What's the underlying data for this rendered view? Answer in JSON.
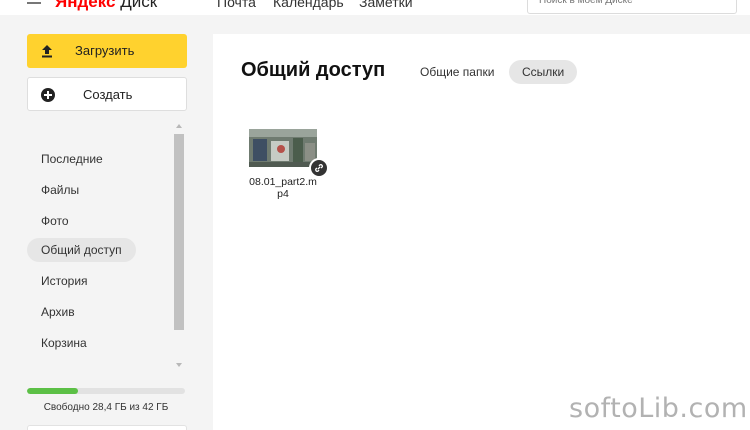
{
  "header": {
    "logo_brand": "Яндекс",
    "logo_product": "Диск",
    "nav": [
      "Почта",
      "Календарь",
      "Заметки"
    ],
    "search_placeholder": "Поиск в моём Диске"
  },
  "sidebar": {
    "upload_label": "Загрузить",
    "create_label": "Создать",
    "items": [
      {
        "label": "Последние",
        "active": false
      },
      {
        "label": "Файлы",
        "active": false
      },
      {
        "label": "Фото",
        "active": false
      },
      {
        "label": "Общий доступ",
        "active": true
      },
      {
        "label": "История",
        "active": false
      },
      {
        "label": "Архив",
        "active": false
      },
      {
        "label": "Корзина",
        "active": false
      }
    ],
    "storage": {
      "text": "Свободно 28,4 ГБ из 42 ГБ",
      "used_fraction": 0.32
    }
  },
  "main": {
    "title": "Общий доступ",
    "tabs": [
      {
        "label": "Общие папки",
        "active": false
      },
      {
        "label": "Ссылки",
        "active": true
      }
    ],
    "files": [
      {
        "name": "08.01_part2.mp4",
        "shared_link": true
      }
    ]
  },
  "watermark": "softoLib.com",
  "colors": {
    "upload_button": "#ffd22e",
    "storage_bar": "#5cc046",
    "logo_brand": "#ff0000",
    "active_pill": "#e6e6e6"
  }
}
